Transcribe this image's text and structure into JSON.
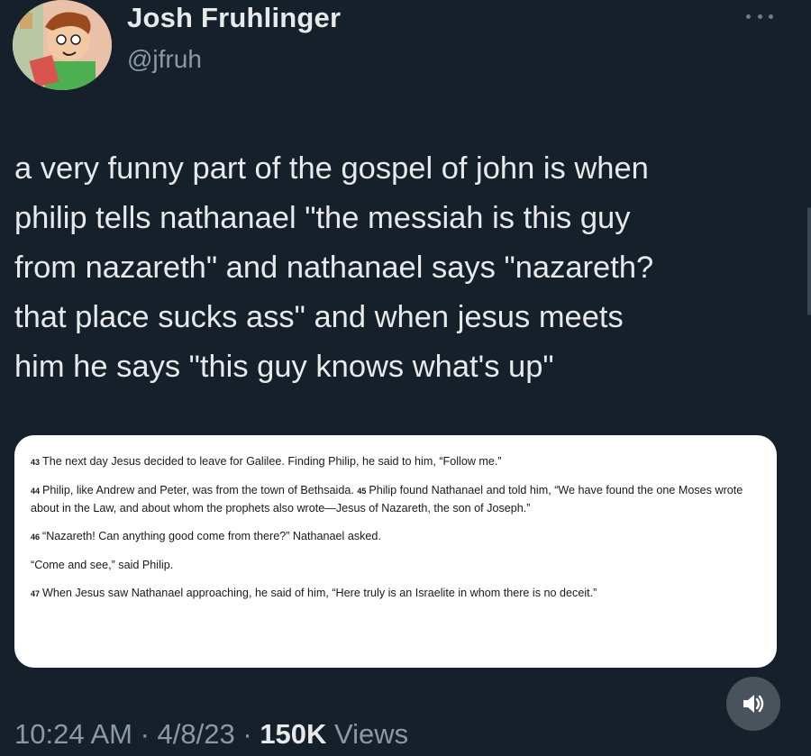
{
  "author": {
    "display_name": "Josh Fruhlinger",
    "handle": "@jfruh"
  },
  "tweet": {
    "text": "a very funny part of the gospel of john is when\nphilip tells nathanael \"the messiah is this guy\nfrom nazareth\" and nathanael says \"nazareth?\nthat place sucks ass\" and when jesus meets\nhim he says \"this guy knows what's up\""
  },
  "quote": {
    "paragraphs": [
      {
        "verses": [
          {
            "num": "43",
            "text": "The next day Jesus decided to leave for Galilee. Finding Philip, he said to him, “Follow me.”"
          }
        ]
      },
      {
        "verses": [
          {
            "num": "44",
            "text": "Philip, like Andrew and Peter, was from the town of Bethsaida."
          },
          {
            "num": "45",
            "text": "Philip found Nathanael and told him, “We have found the one Moses wrote about in the Law, and about whom the prophets also wrote—Jesus of Nazareth, the son of Joseph.”"
          }
        ]
      },
      {
        "verses": [
          {
            "num": "46",
            "text": "“Nazareth! Can anything good come from there?” Nathanael asked."
          }
        ]
      },
      {
        "verses": [
          {
            "num": "",
            "text": "“Come and see,” said Philip."
          }
        ]
      },
      {
        "verses": [
          {
            "num": "47",
            "text": "When Jesus saw Nathanael approaching, he said of him, “Here truly is an Israelite in whom there is no deceit.”"
          }
        ]
      }
    ]
  },
  "meta": {
    "time": "10:24 AM",
    "separator": " · ",
    "date": "4/8/23",
    "views_count": "150K",
    "views_label": " Views"
  },
  "icons": {
    "more": "more-dots-icon",
    "sound": "speaker-icon"
  },
  "colors": {
    "background": "#15202b",
    "text_primary": "#e7e9ea",
    "text_secondary": "#8b98a5",
    "card_background": "#ffffff"
  }
}
